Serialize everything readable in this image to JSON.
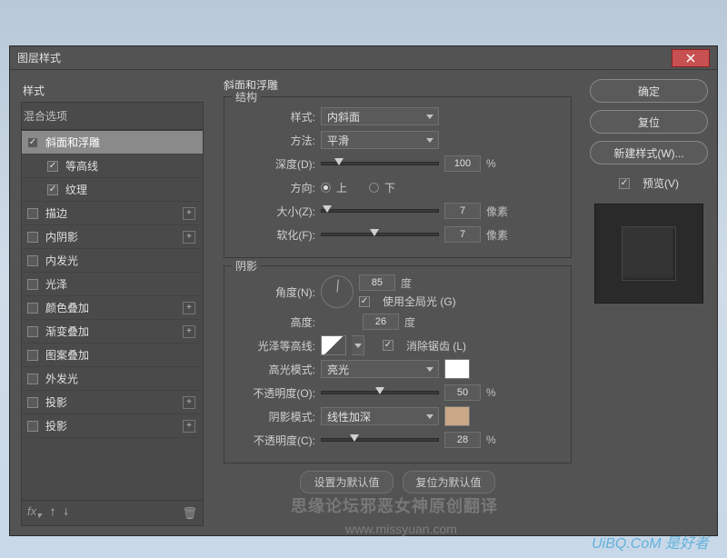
{
  "dialog": {
    "title": "图层样式"
  },
  "left": {
    "styles_label": "样式",
    "blend_options": "混合选项",
    "items": [
      {
        "label": "斜面和浮雕",
        "checked": true,
        "selected": true,
        "plus": false,
        "child": false
      },
      {
        "label": "等高线",
        "checked": true,
        "selected": false,
        "plus": false,
        "child": true
      },
      {
        "label": "纹理",
        "checked": true,
        "selected": false,
        "plus": false,
        "child": true
      },
      {
        "label": "描边",
        "checked": false,
        "selected": false,
        "plus": true,
        "child": false
      },
      {
        "label": "内阴影",
        "checked": false,
        "selected": false,
        "plus": true,
        "child": false
      },
      {
        "label": "内发光",
        "checked": false,
        "selected": false,
        "plus": false,
        "child": false
      },
      {
        "label": "光泽",
        "checked": false,
        "selected": false,
        "plus": false,
        "child": false
      },
      {
        "label": "颜色叠加",
        "checked": false,
        "selected": false,
        "plus": true,
        "child": false
      },
      {
        "label": "渐变叠加",
        "checked": false,
        "selected": false,
        "plus": true,
        "child": false
      },
      {
        "label": "图案叠加",
        "checked": false,
        "selected": false,
        "plus": false,
        "child": false
      },
      {
        "label": "外发光",
        "checked": false,
        "selected": false,
        "plus": false,
        "child": false
      },
      {
        "label": "投影",
        "checked": false,
        "selected": false,
        "plus": true,
        "child": false
      },
      {
        "label": "投影",
        "checked": false,
        "selected": false,
        "plus": true,
        "child": false
      }
    ]
  },
  "center": {
    "title": "斜面和浮雕",
    "structure": {
      "group_label": "结构",
      "style_label": "样式:",
      "style_value": "内斜面",
      "technique_label": "方法:",
      "technique_value": "平滑",
      "depth_label": "深度(D):",
      "depth_value": "100",
      "depth_unit": "%",
      "direction_label": "方向:",
      "dir_up": "上",
      "dir_down": "下",
      "size_label": "大小(Z):",
      "size_value": "7",
      "size_unit": "像素",
      "soften_label": "软化(F):",
      "soften_value": "7",
      "soften_unit": "像素"
    },
    "shadow": {
      "group_label": "阴影",
      "angle_label": "角度(N):",
      "angle_value": "85",
      "angle_unit": "度",
      "global_light": "使用全局光 (G)",
      "altitude_label": "高度:",
      "altitude_value": "26",
      "altitude_unit": "度",
      "gloss_contour_label": "光泽等高线:",
      "antialias": "消除锯齿 (L)",
      "highlight_mode_label": "高光模式:",
      "highlight_mode_value": "亮光",
      "highlight_color": "#ffffff",
      "highlight_opacity_label": "不透明度(O):",
      "highlight_opacity_value": "50",
      "highlight_opacity_unit": "%",
      "shadow_mode_label": "阴影模式:",
      "shadow_mode_value": "线性加深",
      "shadow_color": "#c9a887",
      "shadow_opacity_label": "不透明度(C):",
      "shadow_opacity_value": "28",
      "shadow_opacity_unit": "%"
    },
    "defaults_btn": "设置为默认值",
    "reset_btn": "复位为默认值"
  },
  "right": {
    "ok": "确定",
    "cancel": "复位",
    "new_style": "新建样式(W)...",
    "preview": "预览(V)"
  },
  "watermarks": {
    "w1": "思缘论坛邪恶女神原创翻译",
    "w2": "www.missyuan.com",
    "w3": "UiBQ.CoM 是好者"
  }
}
